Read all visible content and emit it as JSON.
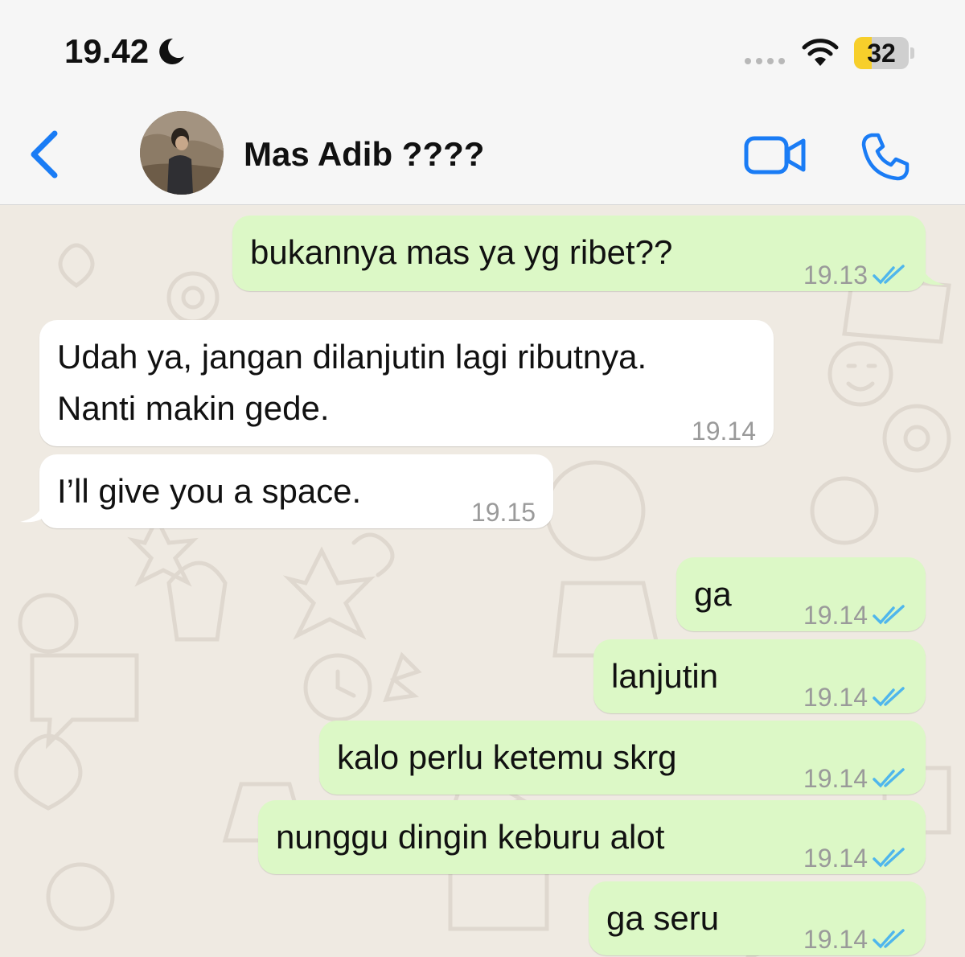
{
  "status_bar": {
    "time": "19.42",
    "battery": "32",
    "battery_level": 0.32,
    "battery_color": "#f7cf2b"
  },
  "header": {
    "contact_name": "Mas Adib ????",
    "accent": "#1a7cf5"
  },
  "messages": [
    {
      "direction": "outgoing",
      "text": "bukannya mas ya yg ribet??",
      "time": "19.13",
      "status": "read"
    },
    {
      "direction": "incoming",
      "lines": [
        "Udah ya, jangan dilanjutin lagi ributnya.",
        "Nanti makin gede."
      ],
      "time": "19.14"
    },
    {
      "direction": "incoming",
      "text": "I’ll give you a space.",
      "time": "19.15"
    },
    {
      "direction": "outgoing",
      "text": "ga",
      "time": "19.14",
      "status": "read"
    },
    {
      "direction": "outgoing",
      "text": "lanjutin",
      "time": "19.14",
      "status": "read"
    },
    {
      "direction": "outgoing",
      "text": "kalo perlu ketemu skrg",
      "time": "19.14",
      "status": "read"
    },
    {
      "direction": "outgoing",
      "text": "nunggu dingin keburu alot",
      "time": "19.14",
      "status": "read"
    },
    {
      "direction": "outgoing",
      "text": "ga seru",
      "time": "19.14",
      "status": "read"
    }
  ],
  "colors": {
    "outgoing_bubble": "#dcf8c6",
    "incoming_bubble": "#ffffff",
    "read_ticks": "#4fb6ec",
    "wallpaper": "#efeae2"
  }
}
